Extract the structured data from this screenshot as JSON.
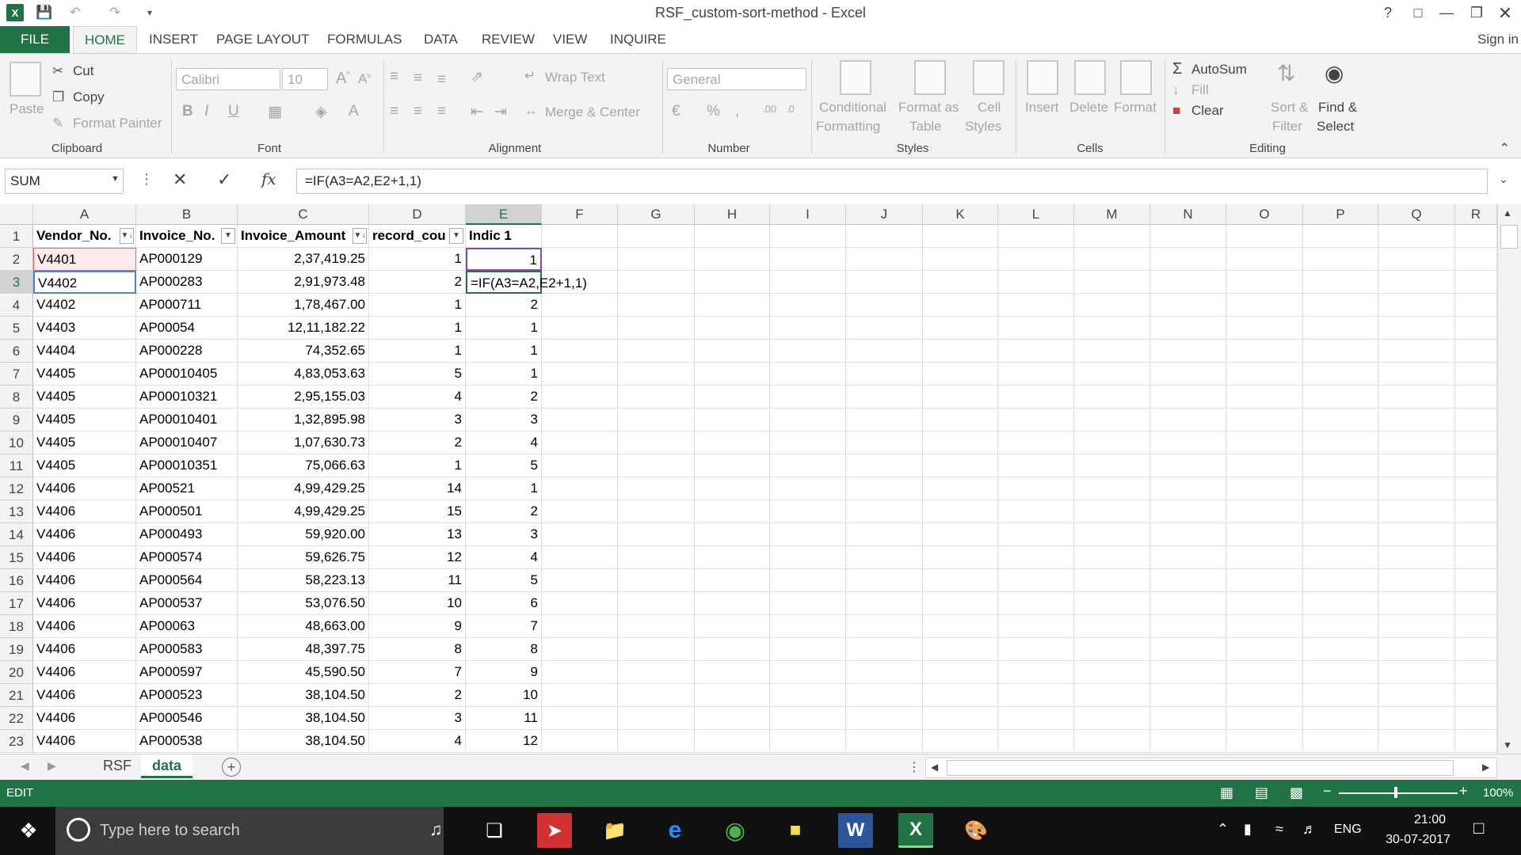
{
  "window": {
    "title": "RSF_custom-sort-method - Excel",
    "help": "?",
    "sign_in": "Sign in"
  },
  "tabs": [
    "FILE",
    "HOME",
    "INSERT",
    "PAGE LAYOUT",
    "FORMULAS",
    "DATA",
    "REVIEW",
    "VIEW",
    "INQUIRE"
  ],
  "ribbon": {
    "clipboard": {
      "paste": "Paste",
      "cut": "Cut",
      "copy": "Copy",
      "format_painter": "Format Painter",
      "label": "Clipboard"
    },
    "font": {
      "name": "Calibri",
      "size": "10",
      "label": "Font"
    },
    "alignment": {
      "wrap": "Wrap Text",
      "merge": "Merge & Center",
      "label": "Alignment"
    },
    "number": {
      "format": "General",
      "label": "Number"
    },
    "styles": {
      "cond1": "Conditional",
      "cond2": "Formatting",
      "fmt1": "Format as",
      "fmt2": "Table",
      "cell1": "Cell",
      "cell2": "Styles",
      "label": "Styles"
    },
    "cells": {
      "insert": "Insert",
      "delete": "Delete",
      "format": "Format",
      "label": "Cells"
    },
    "editing": {
      "autosum": "AutoSum",
      "fill": "Fill",
      "clear": "Clear",
      "sort1": "Sort &",
      "sort2": "Filter",
      "find1": "Find &",
      "find2": "Select",
      "label": "Editing"
    }
  },
  "formula_bar": {
    "name_box": "SUM",
    "formula": "=IF(A3=A2,E2+1,1)"
  },
  "columns": [
    "A",
    "B",
    "C",
    "D",
    "E",
    "F",
    "G",
    "H",
    "I",
    "J",
    "K",
    "L",
    "M",
    "N",
    "O",
    "P",
    "Q",
    "R"
  ],
  "headers": [
    "Vendor_No.",
    "Invoice_No.",
    "Invoice_Amount",
    "record_cou",
    "Indic 1"
  ],
  "rows": [
    [
      "V4401",
      "AP000129",
      "2,37,419.25",
      "1",
      "1"
    ],
    [
      "V4402",
      "AP000283",
      "2,91,973.48",
      "2",
      "=IF(A3=A2,E2+1,1)"
    ],
    [
      "V4402",
      "AP000711",
      "1,78,467.00",
      "1",
      "2"
    ],
    [
      "V4403",
      "AP00054",
      "12,11,182.22",
      "1",
      "1"
    ],
    [
      "V4404",
      "AP000228",
      "74,352.65",
      "1",
      "1"
    ],
    [
      "V4405",
      "AP00010405",
      "4,83,053.63",
      "5",
      "1"
    ],
    [
      "V4405",
      "AP00010321",
      "2,95,155.03",
      "4",
      "2"
    ],
    [
      "V4405",
      "AP00010401",
      "1,32,895.98",
      "3",
      "3"
    ],
    [
      "V4405",
      "AP00010407",
      "1,07,630.73",
      "2",
      "4"
    ],
    [
      "V4405",
      "AP00010351",
      "75,066.63",
      "1",
      "5"
    ],
    [
      "V4406",
      "AP00521",
      "4,99,429.25",
      "14",
      "1"
    ],
    [
      "V4406",
      "AP000501",
      "4,99,429.25",
      "15",
      "2"
    ],
    [
      "V4406",
      "AP000493",
      "59,920.00",
      "13",
      "3"
    ],
    [
      "V4406",
      "AP000574",
      "59,626.75",
      "12",
      "4"
    ],
    [
      "V4406",
      "AP000564",
      "58,223.13",
      "11",
      "5"
    ],
    [
      "V4406",
      "AP000537",
      "53,076.50",
      "10",
      "6"
    ],
    [
      "V4406",
      "AP00063",
      "48,663.00",
      "9",
      "7"
    ],
    [
      "V4406",
      "AP000583",
      "48,397.75",
      "8",
      "8"
    ],
    [
      "V4406",
      "AP000597",
      "45,590.50",
      "7",
      "9"
    ],
    [
      "V4406",
      "AP000523",
      "38,104.50",
      "2",
      "10"
    ],
    [
      "V4406",
      "AP000546",
      "38,104.50",
      "3",
      "11"
    ],
    [
      "V4406",
      "AP000538",
      "38,104.50",
      "4",
      "12"
    ]
  ],
  "sheets": [
    "RSF",
    "data"
  ],
  "active_sheet": "data",
  "status": {
    "mode": "EDIT",
    "zoom": "100%"
  },
  "taskbar": {
    "search_placeholder": "Type here to search",
    "lang": "ENG",
    "time": "21:00",
    "date": "30-07-2017"
  }
}
